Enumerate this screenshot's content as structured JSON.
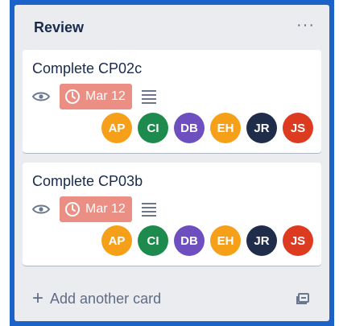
{
  "list": {
    "title": "Review",
    "menu": "···"
  },
  "cards": [
    {
      "title": "Complete CP02c",
      "due": "Mar 12",
      "members": [
        {
          "initials": "AP",
          "color": "#f6a01a"
        },
        {
          "initials": "CI",
          "color": "#1d8a4e"
        },
        {
          "initials": "DB",
          "color": "#6e4fc0"
        },
        {
          "initials": "EH",
          "color": "#f6a01a"
        },
        {
          "initials": "JR",
          "color": "#1f2d4b"
        },
        {
          "initials": "JS",
          "color": "#dd3b1f"
        }
      ]
    },
    {
      "title": "Complete CP03b",
      "due": "Mar 12",
      "members": [
        {
          "initials": "AP",
          "color": "#f6a01a"
        },
        {
          "initials": "CI",
          "color": "#1d8a4e"
        },
        {
          "initials": "DB",
          "color": "#6e4fc0"
        },
        {
          "initials": "EH",
          "color": "#f6a01a"
        },
        {
          "initials": "JR",
          "color": "#1f2d4b"
        },
        {
          "initials": "JS",
          "color": "#dd3b1f"
        }
      ]
    }
  ],
  "footer": {
    "add_label": "Add another card",
    "plus": "+"
  },
  "colors": {
    "frame": "#1b63c9",
    "list_bg": "#ebecf0",
    "due_bg": "#eb8f85"
  }
}
